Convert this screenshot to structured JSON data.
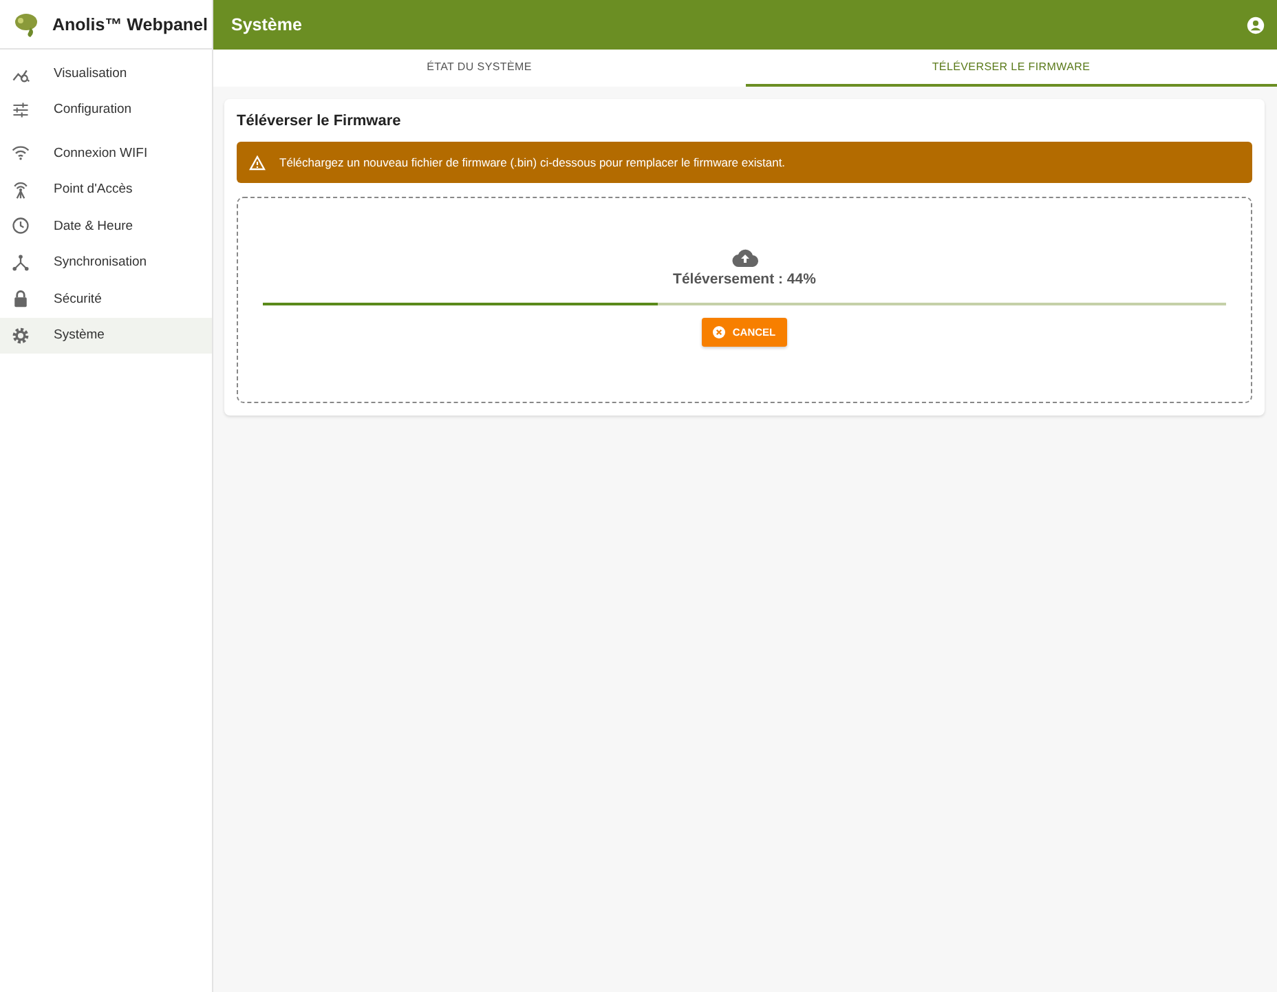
{
  "app": {
    "title": "Anolis™ Webpanel"
  },
  "sidebar": {
    "items": [
      {
        "label": "Visualisation",
        "selected": false
      },
      {
        "label": "Configuration",
        "selected": false
      },
      {
        "label": "Connexion WIFI",
        "selected": false
      },
      {
        "label": "Point d'Accès",
        "selected": false
      },
      {
        "label": "Date & Heure",
        "selected": false
      },
      {
        "label": "Synchronisation",
        "selected": false
      },
      {
        "label": "Sécurité",
        "selected": false
      },
      {
        "label": "Système",
        "selected": true
      }
    ]
  },
  "header": {
    "title": "Système"
  },
  "tabs": [
    {
      "label": "ÉTAT DU SYSTÈME",
      "selected": false
    },
    {
      "label": "TÉLÉVERSER LE FIRMWARE",
      "selected": true
    }
  ],
  "card": {
    "title": "Téléverser le Firmware",
    "alert": "Téléchargez un nouveau fichier de firmware (.bin) ci-dessous pour remplacer le firmware existant.",
    "upload": {
      "status": "Téléversement : 44%",
      "level": 0.41,
      "button": "CANCEL"
    }
  }
}
